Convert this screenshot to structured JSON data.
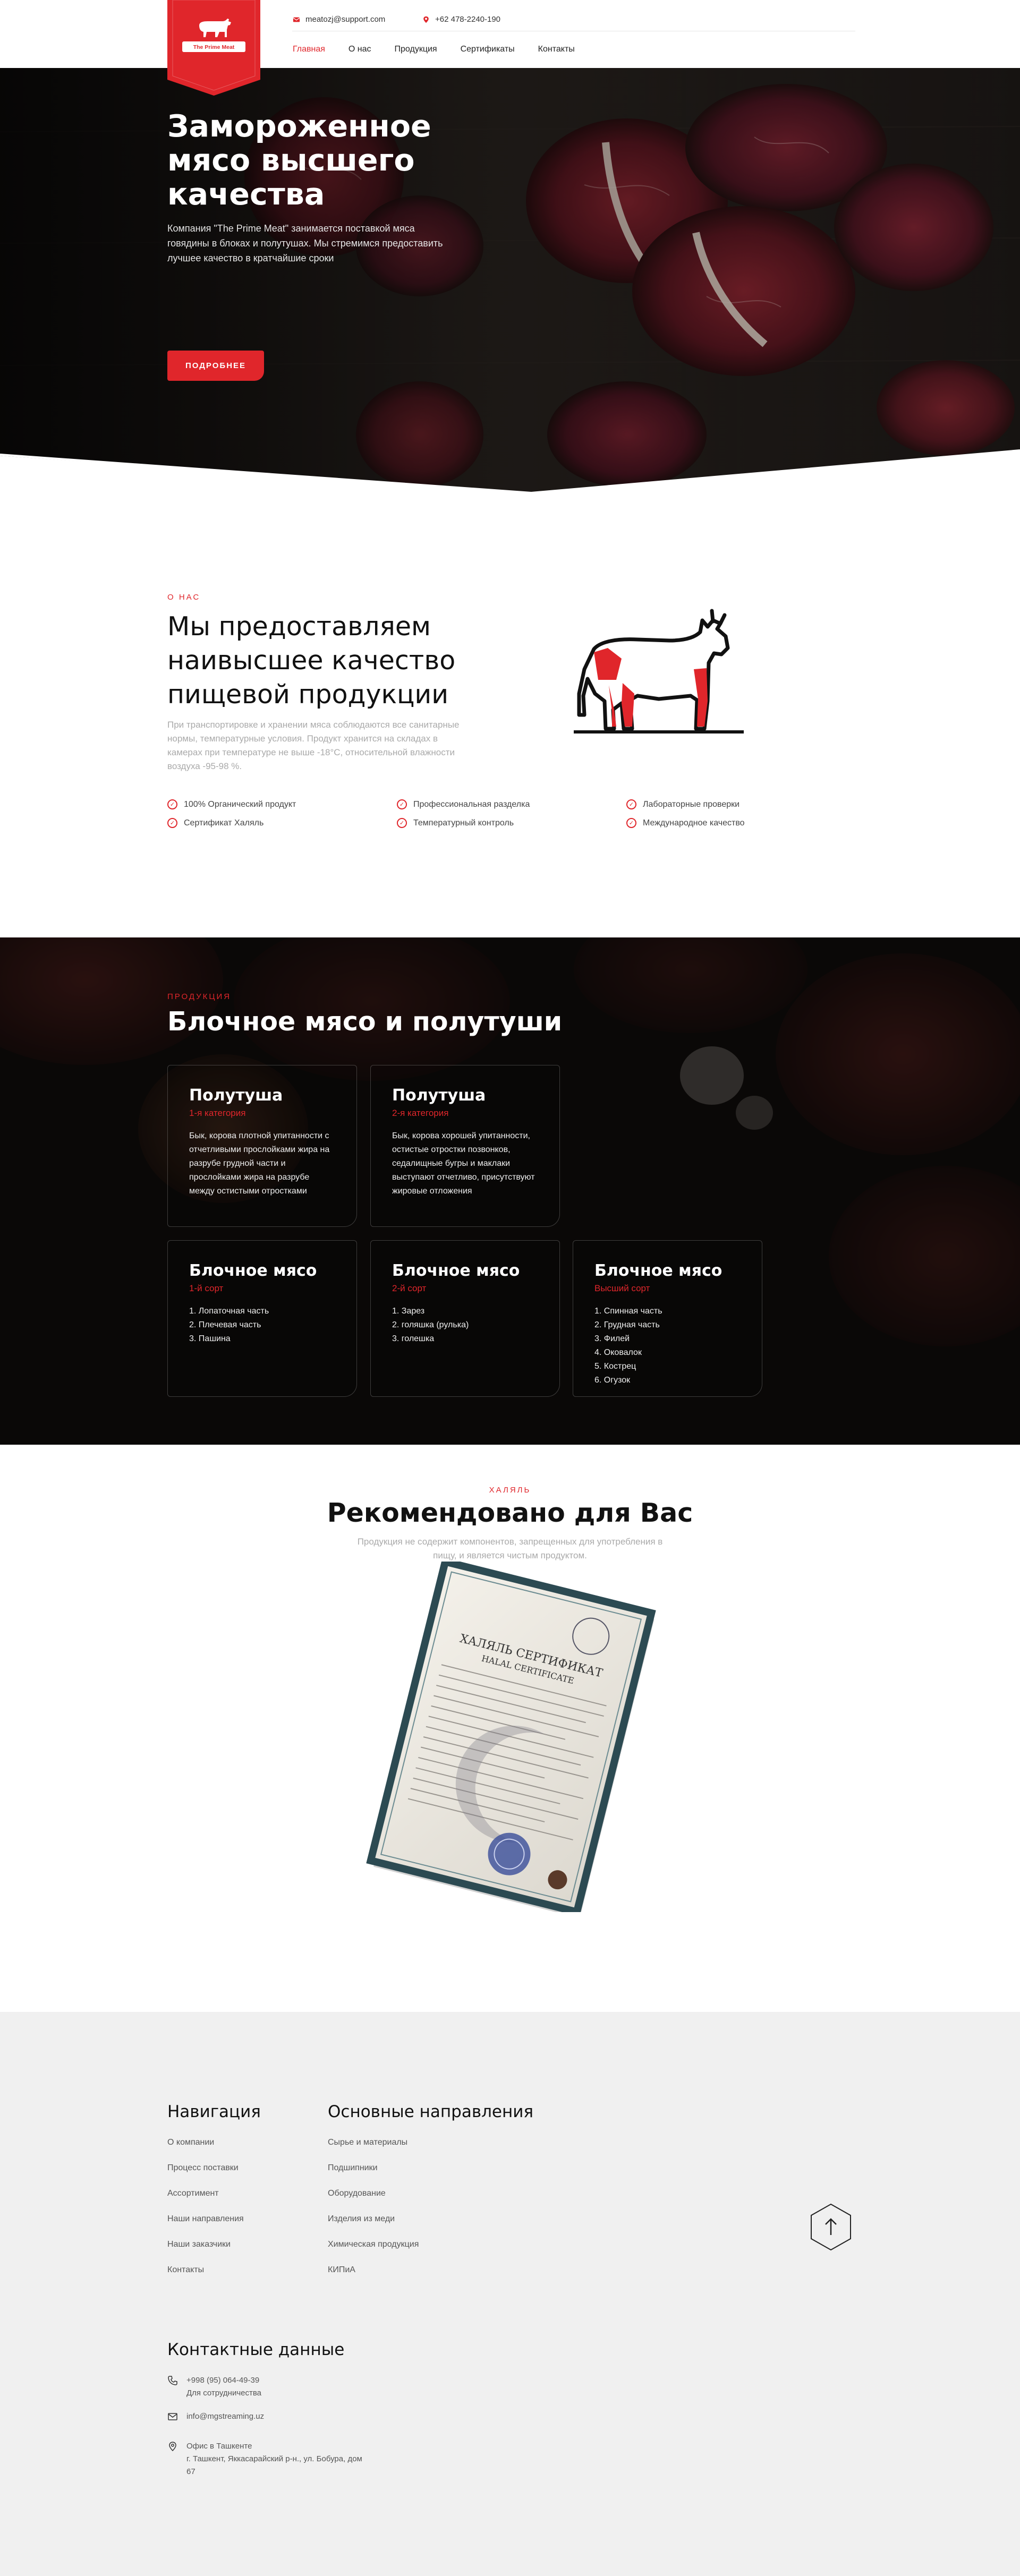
{
  "header": {
    "logo_text": "The Prime Meat",
    "email": "meatozj@support.com",
    "phone": "+62 478-2240-190",
    "nav": [
      {
        "label": "Главная",
        "active": true
      },
      {
        "label": "О нас",
        "active": false
      },
      {
        "label": "Продукция",
        "active": false
      },
      {
        "label": "Сертификаты",
        "active": false
      },
      {
        "label": "Контакты",
        "active": false
      }
    ]
  },
  "hero": {
    "title": "Замороженное мясо высшего качества",
    "description": "Компания \"The Prime Meat\" занимается поставкой мяса говядины в блоках и полутушах. Мы стремимся предоставить лучшее качество в кратчайшие сроки",
    "button": "ПОДРОБНЕЕ"
  },
  "about": {
    "eyebrow": "О НАС",
    "title": "Мы предоставляем наивысшее качество пищевой продукции",
    "description": "При транспортировке и хранении мяса соблюдаются все санитарные нормы, температурные условия. Продукт хранится на складах в камерах при температуре не выше -18°С, относительной влажности воздуха -95-98 %.",
    "features": [
      "100% Органический продукт",
      "Профессиональная разделка",
      "Лабораторные проверки",
      "Сертификат Халяль",
      "Температурный контроль",
      "Международное качество"
    ]
  },
  "products": {
    "eyebrow": "ПРОДУКЦИЯ",
    "title": "Блочное мясо и полутуши",
    "cards": [
      {
        "title": "Полутуша",
        "subtitle": "1-я категория",
        "body": "Бык, корова плотной упитанности с отчетливыми прослойками жира на разрубе грудной части и прослойками жира на разрубе между остистыми отростками"
      },
      {
        "title": "Полутуша",
        "subtitle": "2-я категория",
        "body": "Бык, корова хорошей упитанности, остистые отростки позвонков, седалищные бугры и маклаки выступают отчетливо, присутствуют жировые отложения"
      },
      {
        "title": "Блочное мясо",
        "subtitle": "1-й сорт",
        "items": [
          "1. Лопаточная часть",
          "2. Плечевая часть",
          "3. Пашина"
        ]
      },
      {
        "title": "Блочное мясо",
        "subtitle": "2-й сорт",
        "items": [
          "1. Зарез",
          "2. голяшка (рулька)",
          "3. голешка"
        ]
      },
      {
        "title": "Блочное мясо",
        "subtitle": "Высший сорт",
        "items": [
          "1. Спинная часть",
          "2. Грудная часть",
          "3. Филей",
          "4. Оковалок",
          "5. Кострец",
          "6. Огузок"
        ]
      }
    ]
  },
  "halal": {
    "eyebrow": "ХАЛЯЛЬ",
    "title": "Рекомендовано для Вас",
    "description": "Продукция не содержит компонентов, запрещенных для употребления в пищу, и является чистым продуктом.",
    "certificate_heading": "ХАЛЯЛЬ СЕРТИФИКАТ",
    "certificate_subheading": "HALAL CERTIFICATE"
  },
  "footer": {
    "nav_title": "Навигация",
    "nav_links": [
      "О компании",
      "Процесс поставки",
      "Ассортимент",
      "Наши направления",
      "Наши заказчики",
      "Контакты"
    ],
    "dir_title": "Основные направления",
    "dir_links": [
      "Сырье и материалы",
      "Подшипники",
      "Оборудование",
      "Изделия из меди",
      "Химическая продукция",
      "КИПиА"
    ],
    "contacts_title": "Контактные данные",
    "phone": "+998 (95) 064-49-39",
    "phone_note": "Для сотрудничества",
    "email": "info@mgstreaming.uz",
    "office_title": "Офис в Ташкенте",
    "office_address": "г. Ташкент, Яккасарайский р-н., ул. Бобура, дом 67"
  },
  "colors": {
    "accent": "#e0262b",
    "dark": "#1a1412",
    "footer_bg": "#f0f0f0"
  }
}
